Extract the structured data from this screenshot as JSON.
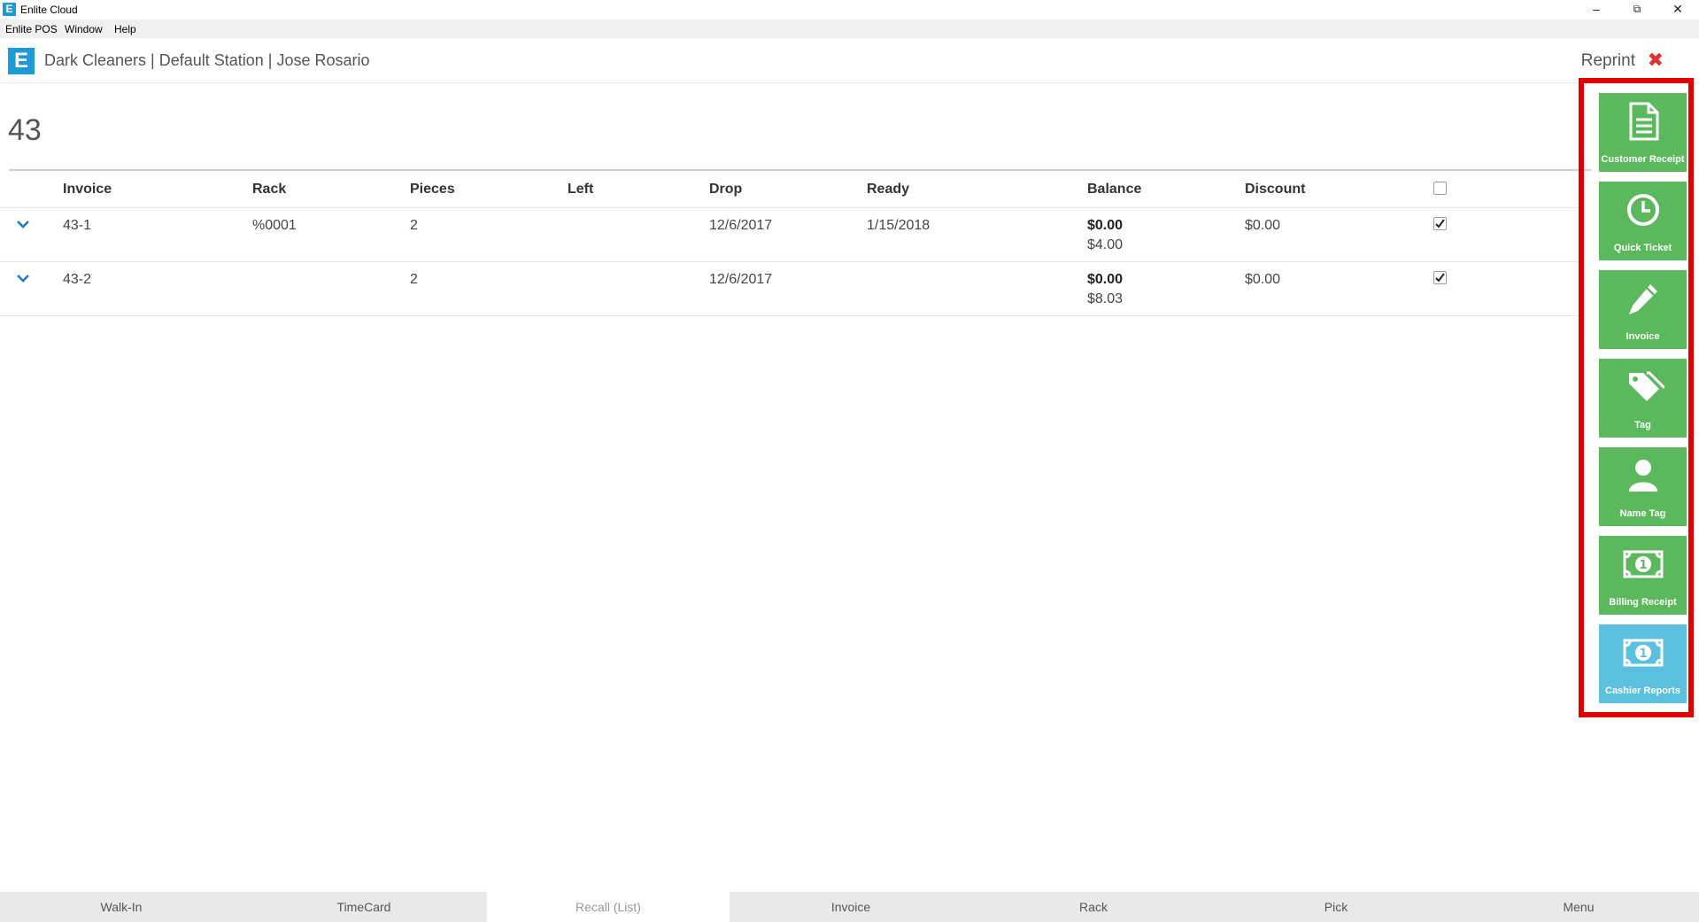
{
  "window": {
    "app_title": "Enlite Cloud",
    "logo_letter": "E"
  },
  "menubar": {
    "items": [
      "Enlite POS",
      "Window",
      "Help"
    ]
  },
  "header": {
    "breadcrumb": "Dark Cleaners | Default Station | Jose Rosario",
    "reprint_label": "Reprint"
  },
  "ticket_number": "43",
  "table": {
    "columns": [
      "Invoice",
      "Rack",
      "Pieces",
      "Left",
      "Drop",
      "Ready",
      "Balance",
      "Discount"
    ],
    "rows": [
      {
        "invoice": "43-1",
        "rack": "%0001",
        "pieces": "2",
        "left": "",
        "drop": "12/6/2017",
        "ready": "1/15/2018",
        "balance": "$0.00",
        "balance_total": "$4.00",
        "discount": "$0.00",
        "checked": true
      },
      {
        "invoice": "43-2",
        "rack": "",
        "pieces": "2",
        "left": "",
        "drop": "12/6/2017",
        "ready": "",
        "balance": "$0.00",
        "balance_total": "$8.03",
        "discount": "$0.00",
        "checked": true
      }
    ]
  },
  "sidebar": {
    "buttons": [
      {
        "label": "Customer Receipt",
        "icon": "document-icon",
        "color": "#5cb85c"
      },
      {
        "label": "Quick Ticket",
        "icon": "clock-icon",
        "color": "#5cb85c"
      },
      {
        "label": "Invoice",
        "icon": "pencil-icon",
        "color": "#5cb85c"
      },
      {
        "label": "Tag",
        "icon": "tags-icon",
        "color": "#5cb85c"
      },
      {
        "label": "Name Tag",
        "icon": "user-icon",
        "color": "#5cb85c"
      },
      {
        "label": "Billing Receipt",
        "icon": "money-icon",
        "color": "#5cb85c"
      },
      {
        "label": "Cashier Reports",
        "icon": "money-icon",
        "color": "#5bc0de"
      }
    ]
  },
  "bottomnav": {
    "tabs": [
      "Walk-In",
      "TimeCard",
      "Recall (List)",
      "Invoice",
      "Rack",
      "Pick",
      "Menu"
    ],
    "active": "Recall (List)"
  },
  "colors": {
    "accent": "#1e9ad6",
    "green": "#5cb85c",
    "blue": "#5bc0de",
    "highlight": "#e00000",
    "close": "#e03030"
  }
}
